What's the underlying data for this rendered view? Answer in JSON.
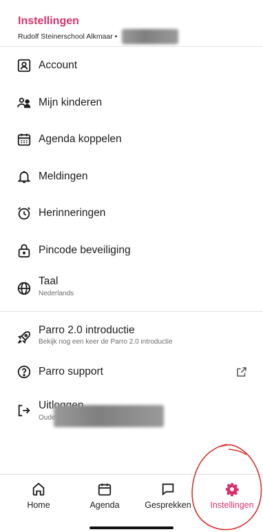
{
  "header": {
    "title": "Instellingen",
    "subtitle": "Rudolf Steinerschool Alkmaar •"
  },
  "menu": {
    "account": "Account",
    "kinderen": "Mijn kinderen",
    "agenda": "Agenda koppelen",
    "meldingen": "Meldingen",
    "herinneringen": "Herinneringen",
    "pincode": "Pincode beveiliging",
    "taal": "Taal",
    "taal_value": "Nederlands",
    "parro_intro": "Parro 2.0 introductie",
    "parro_intro_sub": "Bekijk nog een keer de Parro 2.0 introductie",
    "support": "Parro support",
    "uitloggen": "Uitloggen",
    "uitloggen_sub": "Ouder"
  },
  "tabs": {
    "home": "Home",
    "agenda": "Agenda",
    "gesprekken": "Gesprekken",
    "instellingen": "Instellingen"
  },
  "colors": {
    "accent": "#d6336c",
    "annotation": "#d9302c"
  }
}
